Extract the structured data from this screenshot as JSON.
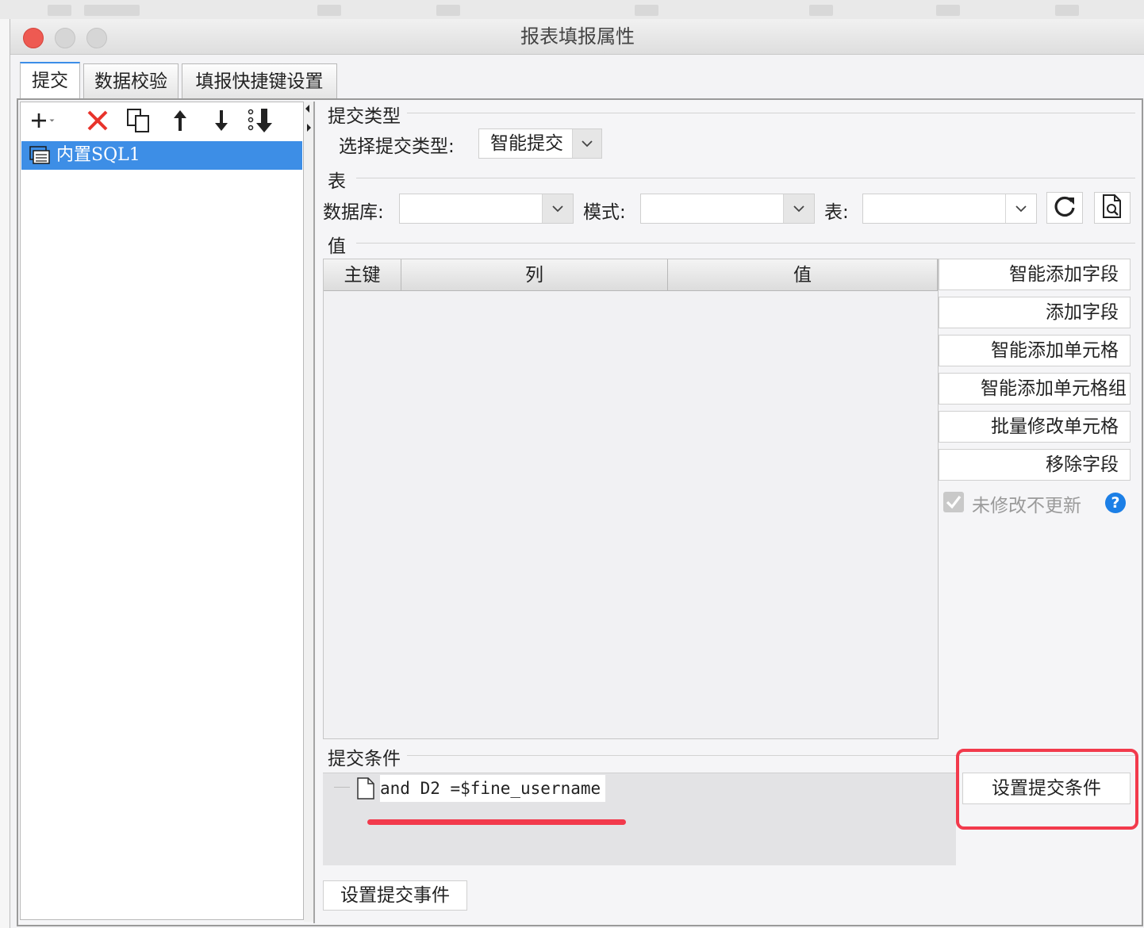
{
  "window": {
    "title": "报表填报属性"
  },
  "tabs": [
    {
      "label": "提交",
      "active": true
    },
    {
      "label": "数据校验",
      "active": false
    },
    {
      "label": "填报快捷键设置",
      "active": false
    }
  ],
  "left_panel": {
    "items": [
      {
        "label": "内置SQL1",
        "selected": true
      }
    ]
  },
  "submit_type": {
    "section_label": "提交类型",
    "field_label": "选择提交类型:",
    "selected": "智能提交"
  },
  "table_section": {
    "section_label": "表",
    "database_label": "数据库:",
    "database_value": "",
    "schema_label": "模式:",
    "schema_value": "",
    "table_label": "表:",
    "table_value": ""
  },
  "value_section": {
    "section_label": "值",
    "columns": [
      "主键",
      "列",
      "值"
    ],
    "rows": []
  },
  "side_buttons": [
    "智能添加字段",
    "添加字段",
    "智能添加单元格",
    "智能添加单元格组",
    "批量修改单元格",
    "移除字段"
  ],
  "no_update_checkbox": {
    "label": "未修改不更新",
    "checked": true,
    "enabled": false
  },
  "conditions": {
    "section_label": "提交条件",
    "items": [
      "and D2 =$fine_username"
    ],
    "set_button": "设置提交条件"
  },
  "event_button": "设置提交事件",
  "colors": {
    "accent": "#3d8ee6",
    "annotation": "#f23a4c",
    "close": "#ee5a52"
  }
}
